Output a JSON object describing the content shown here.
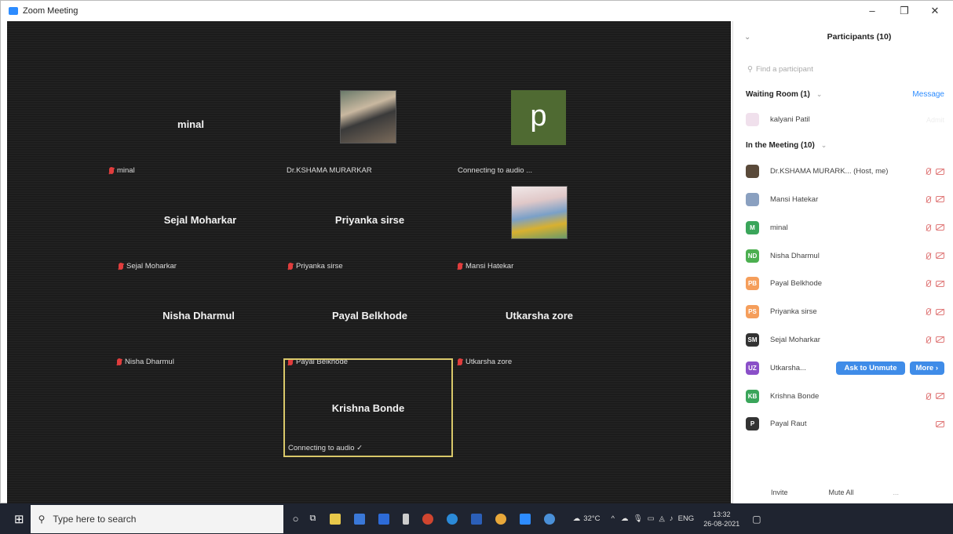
{
  "window": {
    "title": "Zoom Meeting",
    "minimize": "–",
    "maximize": "❐",
    "close": "✕"
  },
  "gallery": {
    "tiles": [
      {
        "big": "minal",
        "small": "minal",
        "muted": true
      },
      {
        "small": "Dr.KSHAMA MURARKAR",
        "muted": false,
        "photo": "photo-a"
      },
      {
        "small": "Connecting to audio ...",
        "muted": false,
        "letter": "p"
      },
      {
        "big": "Sejal Moharkar",
        "small": "Sejal Moharkar",
        "muted": true
      },
      {
        "big": "Priyanka sirse",
        "small": "Priyanka sirse",
        "muted": true
      },
      {
        "small": "Mansi Hatekar",
        "muted": true,
        "photo": "photo-b"
      },
      {
        "big": "Nisha Dharmul",
        "small": "Nisha Dharmul",
        "muted": true
      },
      {
        "big": "Payal Belkhode",
        "small": "Payal Belkhode",
        "muted": true
      },
      {
        "big": "Utkarsha zore",
        "small": "Utkarsha zore",
        "muted": true
      },
      {
        "big": "Krishna Bonde",
        "small": "Connecting to audio ✓",
        "muted": false
      }
    ]
  },
  "panel": {
    "title": "Participants (10)",
    "search_placeholder": "Find a participant",
    "waiting_room": {
      "label": "Waiting Room (1)",
      "message": "Message",
      "person": "kalyani Patil",
      "action": "Admit"
    },
    "in_meeting": {
      "label": "In the Meeting (10)"
    },
    "participants": [
      {
        "name": "Dr.KSHAMA MURARK...  (Host, me)",
        "initials": "",
        "color": "#5a4a3a"
      },
      {
        "name": "Mansi Hatekar",
        "initials": "",
        "color": "#8aa0c0"
      },
      {
        "name": "minal",
        "initials": "M",
        "color": "#3aa55a"
      },
      {
        "name": "Nisha Dharmul",
        "initials": "ND",
        "color": "#4caf50"
      },
      {
        "name": "Payal Belkhode",
        "initials": "PB",
        "color": "#f59e5b"
      },
      {
        "name": "Priyanka sirse",
        "initials": "PS",
        "color": "#f59e5b"
      },
      {
        "name": "Sejal Moharkar",
        "initials": "SM",
        "color": "#333333"
      },
      {
        "name": "Utkarsha...",
        "initials": "UZ",
        "color": "#8a4fc8"
      },
      {
        "name": "Krishna Bonde",
        "initials": "KB",
        "color": "#3aa55a"
      },
      {
        "name": "Payal Raut",
        "initials": "P",
        "color": "#333333"
      }
    ],
    "ask_to_unmute": "Ask to Unmute",
    "more": "More ›",
    "invite": "Invite",
    "mute_all": "Mute All",
    "overflow": "..."
  },
  "taskbar": {
    "search_placeholder": "Type here to search",
    "temperature": "32°C",
    "language": "ENG",
    "time": "13:32",
    "date": "26-08-2021"
  }
}
